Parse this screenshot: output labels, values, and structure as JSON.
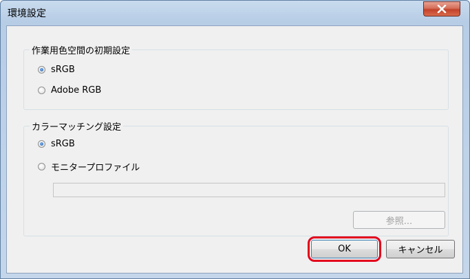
{
  "window": {
    "title": "環境設定",
    "close_icon": "close-icon"
  },
  "initial_workspace": {
    "legend": "作業用色空間の初期設定",
    "options": [
      {
        "label": "sRGB",
        "checked": true
      },
      {
        "label": "Adobe RGB",
        "checked": false
      }
    ]
  },
  "color_matching": {
    "legend": "カラーマッチング設定",
    "options": [
      {
        "label": "sRGB",
        "checked": true
      },
      {
        "label": "モニタープロファイル",
        "checked": false
      }
    ],
    "profile_path": "",
    "browse_label": "参照..."
  },
  "footer": {
    "ok_label": "OK",
    "cancel_label": "キャンセル"
  },
  "colors": {
    "highlight": "#e3001b",
    "close_button": "#c3412a"
  }
}
